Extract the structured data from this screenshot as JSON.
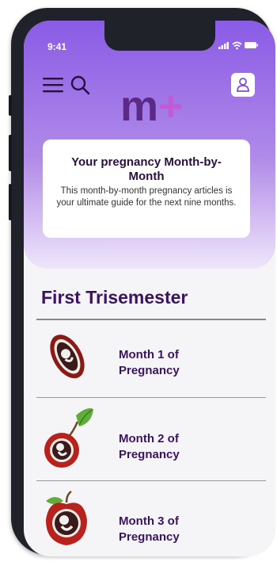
{
  "status": {
    "time": "9:41"
  },
  "header": {
    "logo_text": "m+"
  },
  "intro_card": {
    "title": "Your pregnancy Month-by-Month",
    "description": "This month-by-month pregnancy articles is your ultimate guide for the next nine months."
  },
  "section": {
    "title": "First Trisemester"
  },
  "months": [
    {
      "label": "Month 1 of Pregnancy"
    },
    {
      "label": "Month 2 of Pregnancy"
    },
    {
      "label": "Month 3 of Pregnancy"
    }
  ],
  "colors": {
    "brand_purple": "#8a5be6",
    "heading_purple": "#3b1460",
    "logo_m": "#5b2a86",
    "logo_plus": "#c05ad6"
  }
}
